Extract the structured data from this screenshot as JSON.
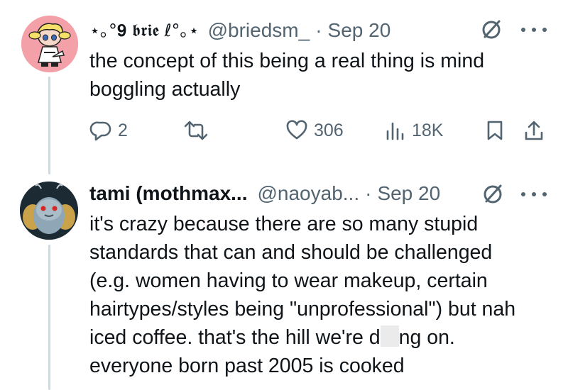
{
  "tweet1": {
    "display_name": "⋆｡°𝟗 𝖇𝖗𝖎𝖊 ℓ°｡⋆",
    "handle": "@briedsm_",
    "separator": "·",
    "time": "Sep 20",
    "text": "the concept of this being a real thing is mind boggling actually",
    "actions": {
      "replies": "2",
      "reposts": "",
      "likes": "306",
      "views": "18K"
    }
  },
  "tweet2": {
    "display_name": "tami (mothmax...",
    "handle": "@naoyab...",
    "separator": "·",
    "time": "Sep 20",
    "text_before_redaction": "it's crazy because there are so many stupid standards that can and should be challenged (e.g. women having to wear makeup, certain hairtypes/styles being \"unprofessional\") but nah iced coffee. that's the hill we're d",
    "text_after_redaction": "ng on. everyone born past 2005 is cooked"
  },
  "colors": {
    "text": "#0f1419",
    "secondary": "#536471",
    "thread_line": "#cfd9de",
    "avatar1_bg": "#f4a0a8",
    "avatar2_bg": "#1c2a33"
  }
}
